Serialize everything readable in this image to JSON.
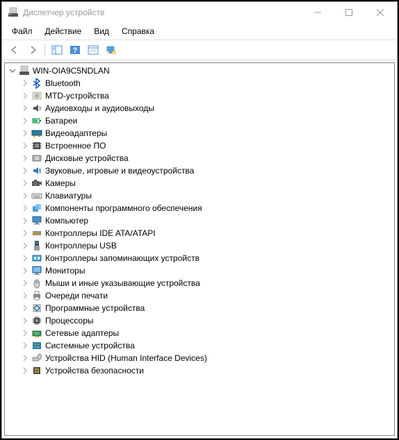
{
  "window": {
    "title": "Диспетчер устройств"
  },
  "menu": {
    "file": "Файл",
    "action": "Действие",
    "view": "Вид",
    "help": "Справка"
  },
  "tree": {
    "root": {
      "label": "WIN-OIA9C5NDLAN",
      "expanded": true
    },
    "items": [
      {
        "icon": "bluetooth",
        "label": "Bluetooth"
      },
      {
        "icon": "mtd",
        "label": "MTD-устройства"
      },
      {
        "icon": "audio",
        "label": "Аудиовходы и аудиовыходы"
      },
      {
        "icon": "battery",
        "label": "Батареи"
      },
      {
        "icon": "display-adapter",
        "label": "Видеоадаптеры"
      },
      {
        "icon": "firmware",
        "label": "Встроенное ПО"
      },
      {
        "icon": "disk",
        "label": "Дисковые устройства"
      },
      {
        "icon": "sound",
        "label": "Звуковые, игровые и видеоустройства"
      },
      {
        "icon": "camera",
        "label": "Камеры"
      },
      {
        "icon": "keyboard",
        "label": "Клавиатуры"
      },
      {
        "icon": "software-component",
        "label": "Компоненты программного обеспечения"
      },
      {
        "icon": "computer",
        "label": "Компьютер"
      },
      {
        "icon": "ide",
        "label": "Контроллеры IDE ATA/ATAPI"
      },
      {
        "icon": "usb",
        "label": "Контроллеры USB"
      },
      {
        "icon": "storage-controller",
        "label": "Контроллеры запоминающих устройств"
      },
      {
        "icon": "monitor",
        "label": "Мониторы"
      },
      {
        "icon": "mouse",
        "label": "Мыши и иные указывающие устройства"
      },
      {
        "icon": "print-queue",
        "label": "Очереди печати"
      },
      {
        "icon": "software-device",
        "label": "Программные устройства"
      },
      {
        "icon": "processor",
        "label": "Процессоры"
      },
      {
        "icon": "network",
        "label": "Сетевые адаптеры"
      },
      {
        "icon": "system-device",
        "label": "Системные устройства"
      },
      {
        "icon": "hid",
        "label": "Устройства HID (Human Interface Devices)"
      },
      {
        "icon": "security",
        "label": "Устройства безопасности"
      }
    ]
  }
}
